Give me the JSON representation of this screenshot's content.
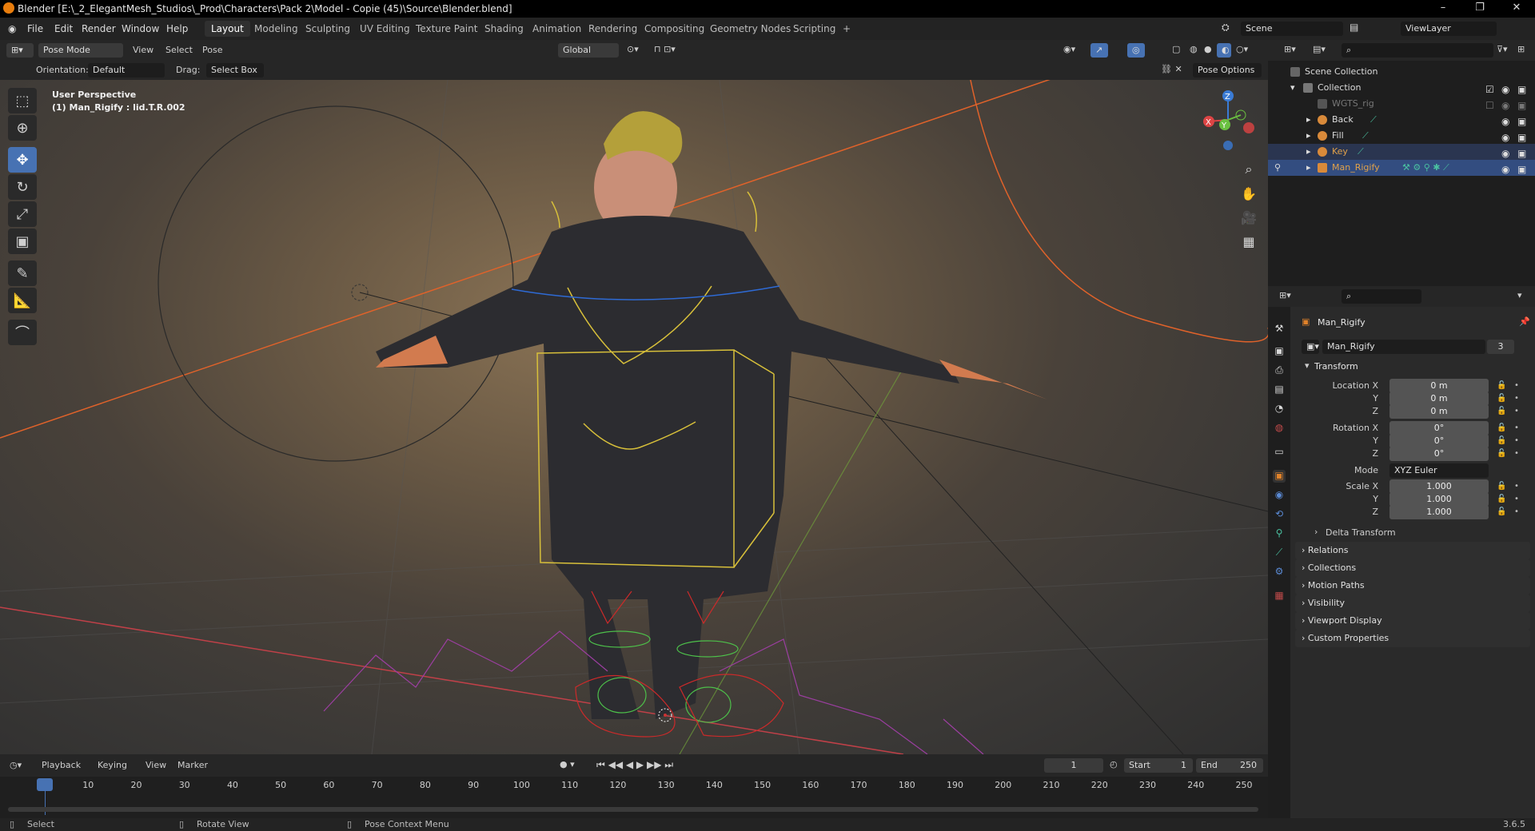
{
  "titlebar": {
    "title": "Blender [E:\\_2_ElegantMesh_Studios\\_Prod\\Characters\\Pack 2\\Model - Copie (45)\\Source\\Blender.blend]",
    "minimize": "–",
    "maximize": "❐",
    "close": "✕"
  },
  "menubar": {
    "items": [
      "File",
      "Edit",
      "Render",
      "Window",
      "Help"
    ]
  },
  "workspaces": {
    "tabs": [
      "Layout",
      "Modeling",
      "Sculpting",
      "UV Editing",
      "Texture Paint",
      "Shading",
      "Animation",
      "Rendering",
      "Compositing",
      "Geometry Nodes",
      "Scripting"
    ],
    "active": "Layout",
    "add": "+"
  },
  "scene": {
    "name": "Scene",
    "viewlayer": "ViewLayer"
  },
  "viewport_header": {
    "mode": "Pose Mode",
    "view": "View",
    "select": "Select",
    "pose": "Pose",
    "transform_orientation": "Global",
    "orientation_label": "Orientation:",
    "orientation_value": "Default",
    "drag_label": "Drag:",
    "drag_value": "Select Box",
    "pose_options": "Pose Options"
  },
  "viewport": {
    "perspective": "User Perspective",
    "object_info": "(1) Man_Rigify : lid.T.R.002",
    "gizmo": {
      "x": "X",
      "y": "Y",
      "z": "Z"
    }
  },
  "tools": [
    "select-box",
    "cursor",
    "move",
    "rotate",
    "scale",
    "transform",
    "annotate",
    "measure",
    "bone-roll"
  ],
  "timeline": {
    "playback": "Playback",
    "keying": "Keying",
    "view": "View",
    "marker": "Marker",
    "current_frame": "1",
    "start_label": "Start",
    "start": "1",
    "end_label": "End",
    "end": "250",
    "ticks": [
      "1",
      "10",
      "20",
      "30",
      "40",
      "50",
      "60",
      "70",
      "80",
      "90",
      "100",
      "110",
      "120",
      "130",
      "140",
      "150",
      "160",
      "170",
      "180",
      "190",
      "200",
      "210",
      "220",
      "230",
      "240",
      "250"
    ]
  },
  "statusbar": {
    "select": "Select",
    "rotate": "Rotate View",
    "context": "Pose Context Menu",
    "version": "3.6.5"
  },
  "outliner": {
    "scene_collection": "Scene Collection",
    "rows": [
      {
        "label": "Collection",
        "indent": 1
      },
      {
        "label": "WGTS_rig",
        "indent": 2
      },
      {
        "label": "Back",
        "indent": 2
      },
      {
        "label": "Fill",
        "indent": 2
      },
      {
        "label": "Key",
        "indent": 2
      },
      {
        "label": "Man_Rigify",
        "indent": 2
      }
    ]
  },
  "properties": {
    "object_name": "Man_Rigify",
    "data_name": "Man_Rigify",
    "users": "3",
    "transform_header": "Transform",
    "location": {
      "label_x": "Location X",
      "label_y": "Y",
      "label_z": "Z",
      "x": "0 m",
      "y": "0 m",
      "z": "0 m"
    },
    "rotation": {
      "label_x": "Rotation X",
      "label_y": "Y",
      "label_z": "Z",
      "x": "0°",
      "y": "0°",
      "z": "0°"
    },
    "mode_label": "Mode",
    "mode": "XYZ Euler",
    "scale": {
      "label_x": "Scale X",
      "label_y": "Y",
      "label_z": "Z",
      "x": "1.000",
      "y": "1.000",
      "z": "1.000"
    },
    "delta": "Delta Transform",
    "panels": [
      "Relations",
      "Collections",
      "Motion Paths",
      "Visibility",
      "Viewport Display",
      "Custom Properties"
    ]
  },
  "colors": {
    "accent": "#4772b3",
    "selection": "#334d80",
    "key_light": "#e0a14a",
    "armature_yellow": "#d8c03a"
  }
}
